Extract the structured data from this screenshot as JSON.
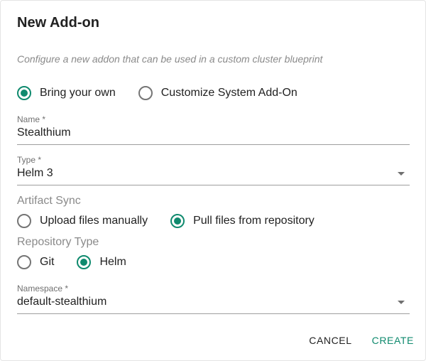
{
  "dialog": {
    "title": "New Add-on",
    "subtitle": "Configure a new addon that can be used in a custom cluster blueprint"
  },
  "source": {
    "options": [
      {
        "label": "Bring your own",
        "checked": true
      },
      {
        "label": "Customize System Add-On",
        "checked": false
      }
    ]
  },
  "name_field": {
    "label": "Name *",
    "value": "Stealthium"
  },
  "type_field": {
    "label": "Type *",
    "value": "Helm 3"
  },
  "artifact_sync": {
    "label": "Artifact Sync",
    "options": [
      {
        "label": "Upload files manually",
        "checked": false
      },
      {
        "label": "Pull files from repository",
        "checked": true
      }
    ]
  },
  "repository_type": {
    "label": "Repository Type",
    "options": [
      {
        "label": "Git",
        "checked": false
      },
      {
        "label": "Helm",
        "checked": true
      }
    ]
  },
  "namespace_field": {
    "label": "Namespace *",
    "value": "default-stealthium"
  },
  "actions": {
    "cancel_label": "CANCEL",
    "create_label": "CREATE"
  },
  "colors": {
    "accent": "#0f8a6e",
    "muted_text": "#8a8a8a"
  }
}
